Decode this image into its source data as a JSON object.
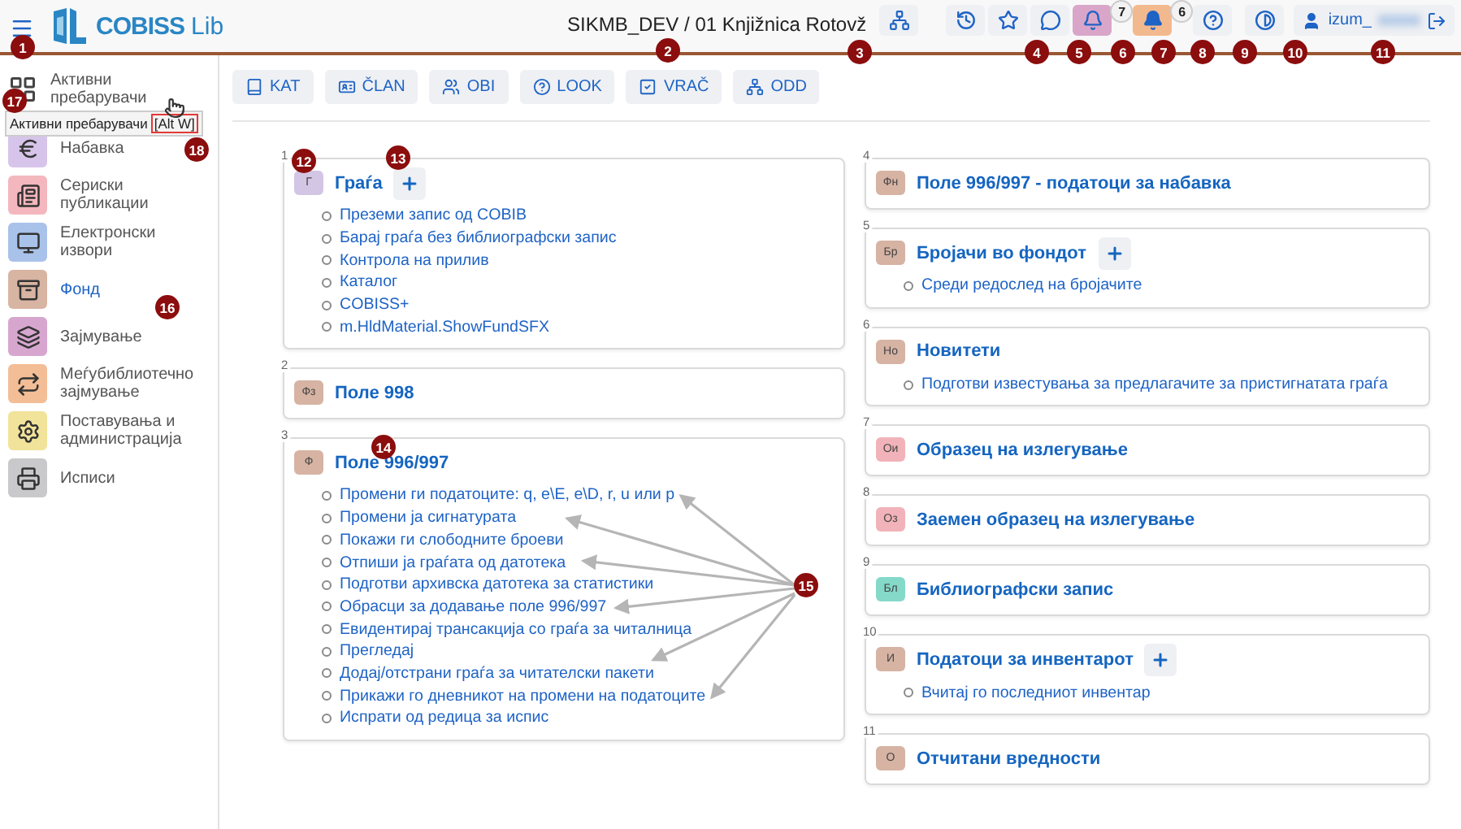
{
  "header": {
    "logo": {
      "mark": "COBISS",
      "suffix": "Lib"
    },
    "title": "SIKMB_DEV / 01 Knjižnica Rotovž",
    "user": "izum_",
    "buttons": [
      {
        "kind": "history"
      },
      {
        "kind": "star"
      },
      {
        "kind": "chat"
      },
      {
        "kind": "bell",
        "color": "#d9a6c9",
        "count": "7"
      },
      {
        "kind": "bell-filled",
        "color": "#f3b98e",
        "count": "6"
      },
      {
        "kind": "help"
      },
      {
        "kind": "contrast"
      }
    ]
  },
  "sidebar": {
    "top": {
      "label": "Активни пребарувачи"
    },
    "tooltip": {
      "text": "Активни пребарувачи",
      "shortcut": "[Alt W]"
    },
    "items": [
      {
        "label": "Набавка",
        "kind": "euro",
        "color": "#d6c4ea",
        "selected": false
      },
      {
        "label": "Сериски публикации",
        "kind": "news",
        "color": "#f3b7bd",
        "selected": false
      },
      {
        "label": "Електронски извори",
        "kind": "monitor",
        "color": "#a9c2ea",
        "selected": false
      },
      {
        "label": "Фонд",
        "kind": "archive",
        "color": "#d8b4a2",
        "selected": true
      },
      {
        "label": "Зајмување",
        "kind": "stack",
        "color": "#d7a6cf",
        "selected": false
      },
      {
        "label": "Меѓубиблиотечно зајмување",
        "kind": "exchange",
        "color": "#f3bd96",
        "selected": false
      },
      {
        "label": "Поставувања и администрација",
        "kind": "gears",
        "color": "#f1e39a",
        "selected": false
      },
      {
        "label": "Исписи",
        "kind": "printer",
        "color": "#c9c9cb",
        "selected": false
      }
    ]
  },
  "toolbar": [
    {
      "label": "KAT",
      "kind": "book"
    },
    {
      "label": "ČLAN",
      "kind": "card"
    },
    {
      "label": "OBI",
      "kind": "users"
    },
    {
      "label": "LOOK",
      "kind": "help"
    },
    {
      "label": "VRAČ",
      "kind": "check"
    },
    {
      "label": "ODD",
      "kind": "sitemap"
    }
  ],
  "columns": [
    [
      {
        "number": "1",
        "badge": "Г",
        "color": "#d3c6e4",
        "title": "Граѓа",
        "add": true,
        "links": [
          "Преземи запис од COBIB",
          "Барај граѓа без библиографски запис",
          "Контрола на прилив",
          "Каталог",
          "COBISS+",
          "m.HldMaterial.ShowFundSFX"
        ]
      },
      {
        "number": "2",
        "badge": "Фз",
        "color": "#d6b3a3",
        "title": "Поле 998",
        "add": false
      },
      {
        "number": "3",
        "badge": "Ф",
        "color": "#d6b3a3",
        "title": "Поле 996/997",
        "add": false,
        "links": [
          "Промени ги податоците: q, e\\E, e\\D, r, u или p",
          "Промени ја сигнатурата",
          "Покажи ги слободните броеви",
          "Отпиши ја граѓата од датотека",
          "Подготви архивска датотека за статистики",
          "Обрасци за додавање поле 996/997",
          "Евидентирај трансакција со граѓа за читалница",
          "Прегледај",
          "Додај/отстрани граѓа за читателски пакети",
          "Прикажи го дневникот на промени на податоците",
          "Испрати од редица за испис"
        ]
      }
    ],
    [
      {
        "number": "4",
        "badge": "Фн",
        "color": "#d6b3a3",
        "title": "Поле 996/997 - податоци за набавка",
        "add": false
      },
      {
        "number": "5",
        "badge": "Бр",
        "color": "#d6b3a3",
        "title": "Бројачи во фондот",
        "add": true,
        "links": [
          "Среди редослед на бројачите"
        ]
      },
      {
        "number": "6",
        "badge": "Но",
        "color": "#d6b3a3",
        "title": "Новитети",
        "add": false,
        "links": [
          "Подготви известувања за предлагачите за пристигнатата граѓа"
        ]
      },
      {
        "number": "7",
        "badge": "Ои",
        "color": "#f1b3b9",
        "title": "Образец на излегување",
        "add": false
      },
      {
        "number": "8",
        "badge": "Оз",
        "color": "#f1b3b9",
        "title": "Заемен образец на излегување",
        "add": false
      },
      {
        "number": "9",
        "badge": "Бл",
        "color": "#84d9c9",
        "title": "Библиографски запис",
        "add": false
      },
      {
        "number": "10",
        "badge": "И",
        "color": "#d6b3a3",
        "title": "Податоци за инвентарот",
        "add": true,
        "links": [
          "Вчитај го последниот инвентар"
        ]
      },
      {
        "number": "11",
        "badge": "О",
        "color": "#d6b3a3",
        "title": "Отчитани вредности",
        "add": false
      }
    ]
  ],
  "callouts": [
    "1",
    "2",
    "3",
    "4",
    "5",
    "6",
    "7",
    "8",
    "9",
    "10",
    "11",
    "12",
    "13",
    "14",
    "15",
    "16",
    "17",
    "18"
  ]
}
